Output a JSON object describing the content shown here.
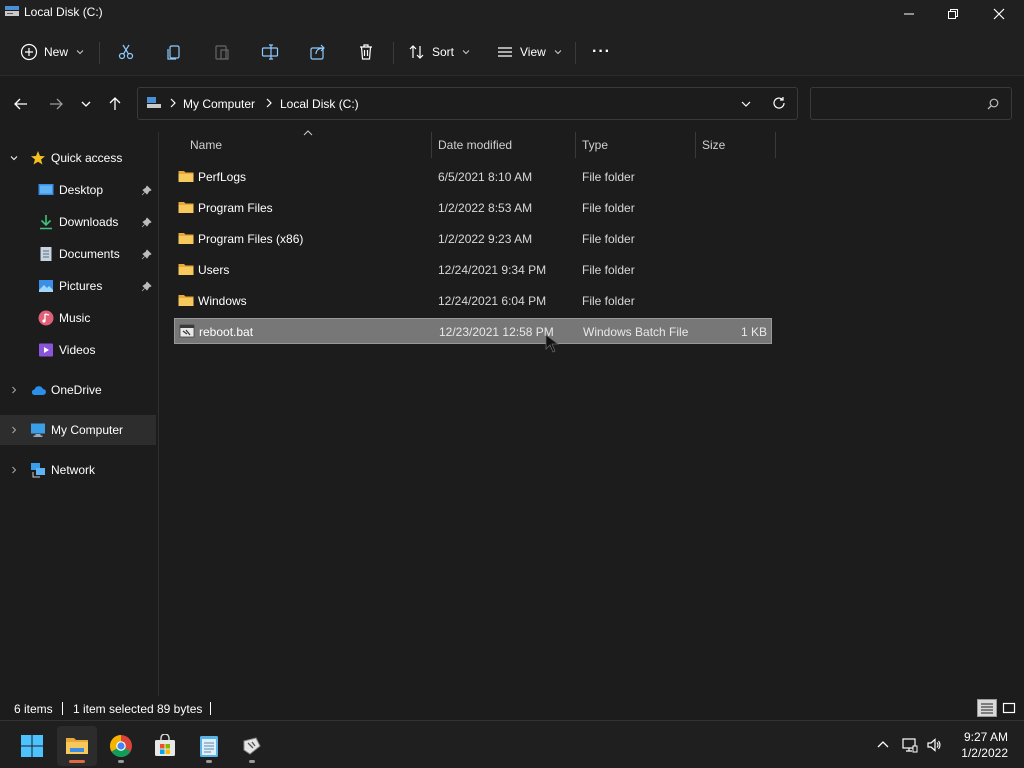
{
  "window": {
    "title": "Local Disk (C:)"
  },
  "toolbar": {
    "new_label": "New",
    "sort_label": "Sort",
    "view_label": "View",
    "more_label": "···"
  },
  "address": {
    "crumbs": [
      "My Computer",
      "Local Disk (C:)"
    ],
    "search_placeholder": ""
  },
  "sidebar": {
    "quick_access": "Quick access",
    "items": [
      {
        "label": "Desktop",
        "icon": "desktop-icon",
        "pinned": true
      },
      {
        "label": "Downloads",
        "icon": "download-icon",
        "pinned": true
      },
      {
        "label": "Documents",
        "icon": "document-icon",
        "pinned": true
      },
      {
        "label": "Pictures",
        "icon": "picture-icon",
        "pinned": true
      },
      {
        "label": "Music",
        "icon": "music-icon",
        "pinned": false
      },
      {
        "label": "Videos",
        "icon": "video-icon",
        "pinned": false
      }
    ],
    "onedrive": "OneDrive",
    "my_computer": "My Computer",
    "network": "Network"
  },
  "columns": {
    "name": "Name",
    "date": "Date modified",
    "type": "Type",
    "size": "Size"
  },
  "files": [
    {
      "name": "PerfLogs",
      "date": "6/5/2021 8:10 AM",
      "type": "File folder",
      "size": "",
      "icon": "folder-icon"
    },
    {
      "name": "Program Files",
      "date": "1/2/2022 8:53 AM",
      "type": "File folder",
      "size": "",
      "icon": "folder-icon"
    },
    {
      "name": "Program Files (x86)",
      "date": "1/2/2022 9:23 AM",
      "type": "File folder",
      "size": "",
      "icon": "folder-icon"
    },
    {
      "name": "Users",
      "date": "12/24/2021 9:34 PM",
      "type": "File folder",
      "size": "",
      "icon": "folder-icon"
    },
    {
      "name": "Windows",
      "date": "12/24/2021 6:04 PM",
      "type": "File folder",
      "size": "",
      "icon": "folder-icon"
    },
    {
      "name": "reboot.bat",
      "date": "12/23/2021 12:58 PM",
      "type": "Windows Batch File",
      "size": "1 KB",
      "icon": "batch-file-icon",
      "selected": true
    }
  ],
  "status": {
    "item_count": "6 items",
    "selection": "1 item selected",
    "selection_size": "89 bytes"
  },
  "taskbar": {
    "time": "9:27 AM",
    "date": "1/2/2022"
  },
  "colors": {
    "folder": "#f4c55a",
    "accent": "#4cc2ff",
    "selection": "#777777",
    "taskbar_active": "#e06a45"
  }
}
